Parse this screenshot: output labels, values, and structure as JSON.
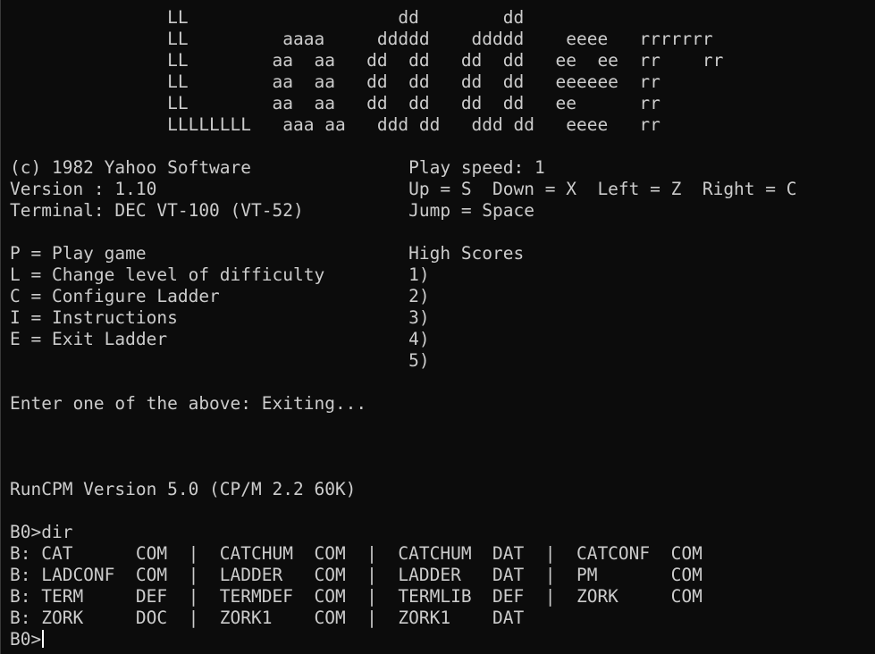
{
  "terminal": {
    "lines": [
      "               LL                    dd        dd",
      "               LL         aaaa     ddddd    ddddd    eeee   rrrrrrr",
      "               LL        aa  aa   dd  dd   dd  dd   ee  ee  rr    rr",
      "               LL        aa  aa   dd  dd   dd  dd   eeeeee  rr",
      "               LL        aa  aa   dd  dd   dd  dd   ee      rr",
      "               LLLLLLLL   aaa aa   ddd dd   ddd dd   eeee   rr",
      "",
      "(c) 1982 Yahoo Software               Play speed: 1",
      "Version : 1.10                        Up = S  Down = X  Left = Z  Right = C",
      "Terminal: DEC VT-100 (VT-52)          Jump = Space",
      "",
      "P = Play game                         High Scores",
      "L = Change level of difficulty        1)",
      "C = Configure Ladder                  2)",
      "I = Instructions                      3)",
      "E = Exit Ladder                       4)",
      "                                      5)",
      "",
      "Enter one of the above: Exiting...",
      "",
      "",
      "",
      "RunCPM Version 5.0 (CP/M 2.2 60K)",
      "",
      "B0>dir",
      "B: CAT      COM  |  CATCHUM  COM  |  CATCHUM  DAT  |  CATCONF  COM",
      "B: LADCONF  COM  |  LADDER   COM  |  LADDER   DAT  |  PM       COM",
      "B: TERM     DEF  |  TERMDEF  COM  |  TERMLIB  DEF  |  ZORK     COM",
      "B: ZORK     DOC  |  ZORK1    COM  |  ZORK1    DAT"
    ],
    "prompt": "B0>"
  },
  "colors": {
    "background": "#0c0c0c",
    "foreground": "#cccccc",
    "cursor": "#ffffff"
  }
}
